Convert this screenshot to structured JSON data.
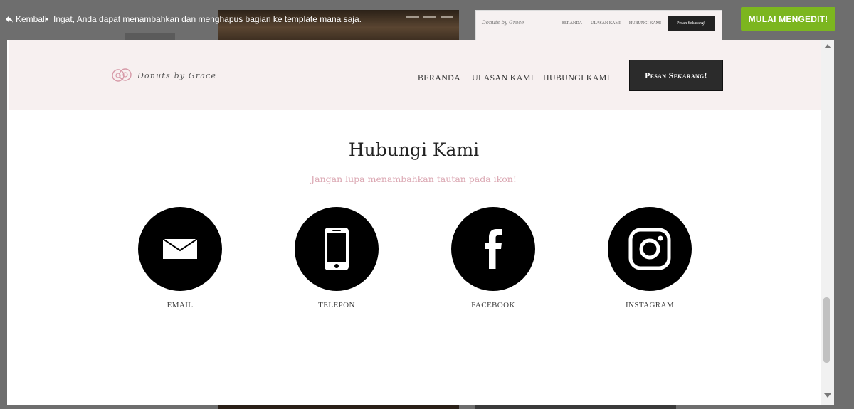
{
  "topbar": {
    "back_label": "Kembali",
    "separator": "•",
    "notice": "Ingat, Anda dapat menambahkan dan menghapus bagian ke template mana saja.",
    "start_edit_label": "MULAI MENGEDIT!"
  },
  "header": {
    "logo_text": "Donuts by Grace",
    "nav": [
      "BERANDA",
      "ULASAN KAMI",
      "HUBUNGI KAMI"
    ],
    "order_button": "Pesan Sekarang!"
  },
  "section": {
    "title": "Hubungi Kami",
    "subtitle": "Jangan lupa menambahkan tautan pada ikon!"
  },
  "contacts": [
    {
      "label": "EMAIL",
      "icon": "envelope-icon"
    },
    {
      "label": "TELEPON",
      "icon": "phone-icon"
    },
    {
      "label": "FACEBOOK",
      "icon": "facebook-icon"
    },
    {
      "label": "INSTAGRAM",
      "icon": "instagram-icon"
    }
  ],
  "colors": {
    "accent_green": "#7cb61f",
    "header_bg": "#f7f0f0",
    "subtitle_pink": "#dba7b2",
    "order_button_bg": "#2b2b2b"
  }
}
